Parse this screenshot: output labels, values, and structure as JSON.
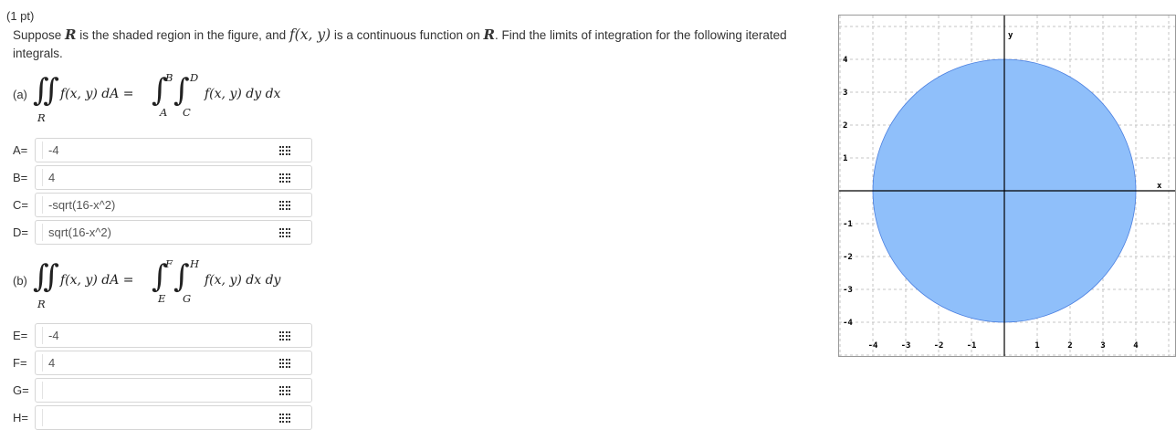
{
  "problem": {
    "points": "(1 pt)",
    "prompt_a": "Suppose ",
    "var_R": "R",
    "prompt_b": " is the shaded region in the figure, and ",
    "func": "f(x, y)",
    "prompt_c": " is a continuous function on ",
    "var_R2": "R",
    "prompt_d": ". Find the limits of integration for the following iterated integrals."
  },
  "part_a": {
    "label": "(a)",
    "integrand": "f(x, y) dA =",
    "region": "R",
    "outer_upper": "B",
    "outer_lower": "A",
    "inner_upper": "D",
    "inner_lower": "C",
    "iterated": "f(x, y) dy dx",
    "answers": [
      {
        "label": "A=",
        "value": "-4"
      },
      {
        "label": "B=",
        "value": "4"
      },
      {
        "label": "C=",
        "value": "-sqrt(16-x^2)"
      },
      {
        "label": "D=",
        "value": "sqrt(16-x^2)"
      }
    ]
  },
  "part_b": {
    "label": "(b)",
    "integrand": "f(x, y) dA =",
    "region": "R",
    "outer_upper": "F",
    "outer_lower": "E",
    "inner_upper": "H",
    "inner_lower": "G",
    "iterated": "f(x, y) dx dy",
    "answers": [
      {
        "label": "E=",
        "value": "-4"
      },
      {
        "label": "F=",
        "value": "4"
      },
      {
        "label": "G=",
        "value": ""
      },
      {
        "label": "H=",
        "value": ""
      }
    ]
  },
  "graph": {
    "x_axis_label": "x",
    "y_axis_label": "y",
    "x_ticks": [
      "-4",
      "-3",
      "-2",
      "-1",
      "1",
      "2",
      "3",
      "4"
    ],
    "y_ticks": [
      "4",
      "3",
      "2",
      "1",
      "-1",
      "-2",
      "-3",
      "-4"
    ],
    "region_radius": 4,
    "fill_color": "#8fbffa",
    "stroke_color": "#4a7fe0"
  }
}
